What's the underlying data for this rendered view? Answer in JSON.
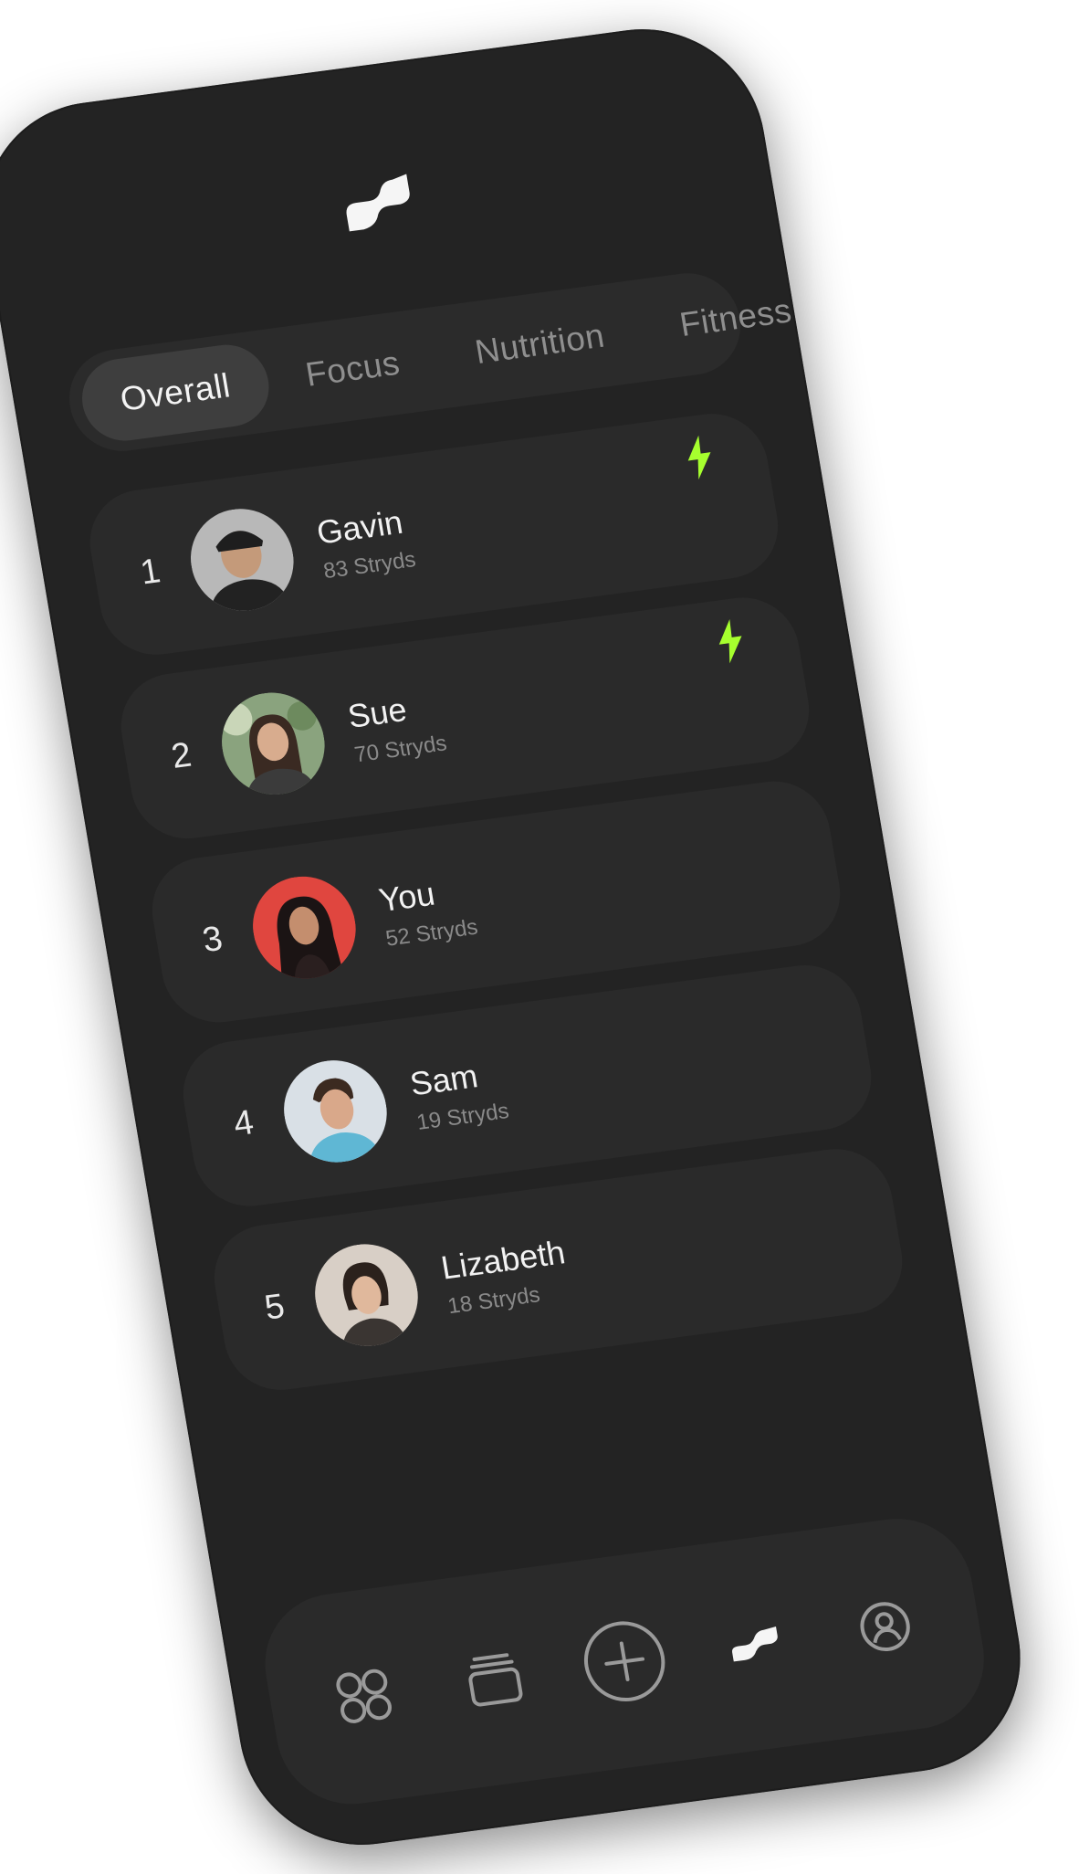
{
  "tabs": [
    {
      "label": "Overall",
      "active": true
    },
    {
      "label": "Focus",
      "active": false
    },
    {
      "label": "Nutrition",
      "active": false
    },
    {
      "label": "Fitness",
      "active": false
    }
  ],
  "leaderboard": [
    {
      "rank": "1",
      "name": "Gavin",
      "score": "83 Stryds",
      "bolt": true,
      "avatar_bg": "#b8b8b8"
    },
    {
      "rank": "2",
      "name": "Sue",
      "score": "70 Stryds",
      "bolt": true,
      "avatar_bg": "#8aa37e"
    },
    {
      "rank": "3",
      "name": "You",
      "score": "52 Stryds",
      "bolt": false,
      "avatar_bg": "#e0463f"
    },
    {
      "rank": "4",
      "name": "Sam",
      "score": "19 Stryds",
      "bolt": false,
      "avatar_bg": "#d9e0e6"
    },
    {
      "rank": "5",
      "name": "Lizabeth",
      "score": "18 Stryds",
      "bolt": false,
      "avatar_bg": "#d8cfc6"
    }
  ],
  "bottom_nav": [
    {
      "icon": "grid-circles-icon",
      "active": false
    },
    {
      "icon": "cards-stack-icon",
      "active": false
    },
    {
      "icon": "add-circle-icon",
      "active": false
    },
    {
      "icon": "stryd-logo-icon",
      "active": true
    },
    {
      "icon": "profile-icon",
      "active": false
    }
  ],
  "colors": {
    "background": "#232323",
    "card": "#2a2a2a",
    "accent": "#a6ff2e",
    "text": "#f2f2f2",
    "muted": "#8a8a8a"
  }
}
